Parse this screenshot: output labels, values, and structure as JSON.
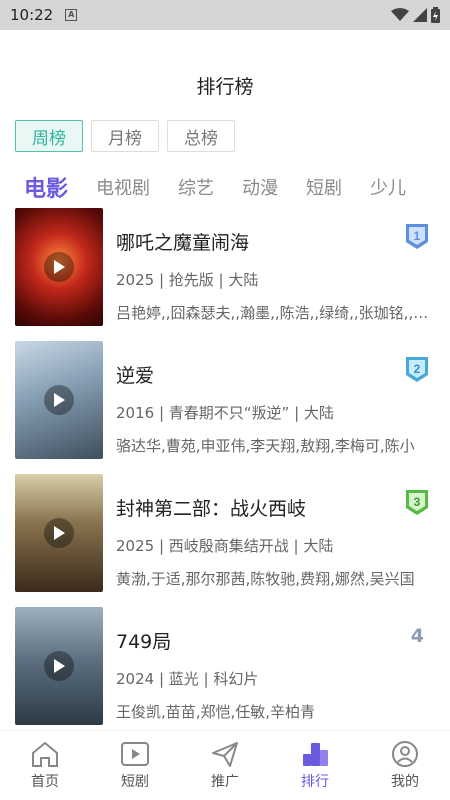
{
  "status": {
    "time": "10:22"
  },
  "page": {
    "title": "排行榜"
  },
  "period_tabs": [
    {
      "label": "周榜",
      "active": true
    },
    {
      "label": "月榜",
      "active": false
    },
    {
      "label": "总榜",
      "active": false
    }
  ],
  "category_tabs": [
    {
      "label": "电影",
      "active": true
    },
    {
      "label": "电视剧",
      "active": false
    },
    {
      "label": "综艺",
      "active": false
    },
    {
      "label": "动漫",
      "active": false
    },
    {
      "label": "短剧",
      "active": false
    },
    {
      "label": "少儿",
      "active": false
    }
  ],
  "items": [
    {
      "rank": "1",
      "title": "哪吒之魔童闹海",
      "meta": "2025 | 抢先版 | 大陆",
      "cast": "吕艳婷,,囧森瑟夫,,瀚墨,,陈浩,,绿绮,,张珈铭,,杨卫"
    },
    {
      "rank": "2",
      "title": "逆爱",
      "meta": "2016 | 青春期不只“叛逆” | 大陆",
      "cast": "骆达华,曹苑,申亚伟,李天翔,敖翔,李梅可,陈小"
    },
    {
      "rank": "3",
      "title": "封神第二部：战火西岐",
      "meta": "2025 | 西岐殷商集结开战 | 大陆",
      "cast": "黄渤,于适,那尔那茜,陈牧驰,费翔,娜然,吴兴国"
    },
    {
      "rank": "4",
      "title": "749局",
      "meta": "2024 | 蓝光 | 科幻片",
      "cast": "王俊凯,苗苗,郑恺,任敏,辛柏青"
    }
  ],
  "bottom_nav": [
    {
      "label": "首页",
      "icon": "home-icon",
      "active": false
    },
    {
      "label": "短剧",
      "icon": "video-icon",
      "active": false
    },
    {
      "label": "推广",
      "icon": "send-icon",
      "active": false
    },
    {
      "label": "排行",
      "icon": "rank-icon",
      "active": true
    },
    {
      "label": "我的",
      "icon": "user-icon",
      "active": false
    }
  ],
  "colors": {
    "accent": "#6a5ae0",
    "teal": "#2bb3a0"
  }
}
